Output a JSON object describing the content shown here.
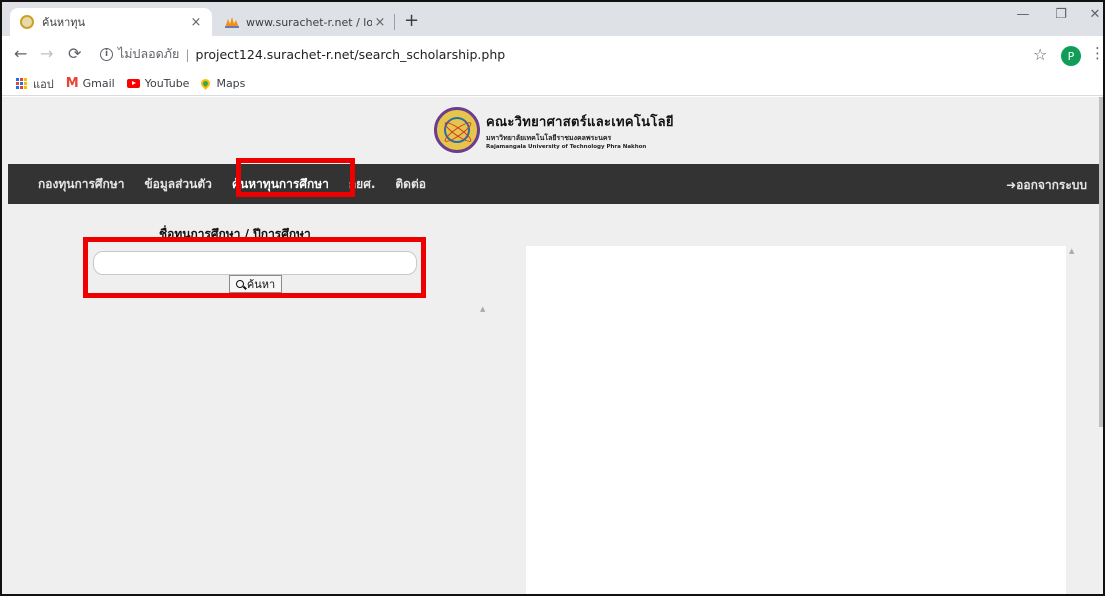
{
  "browser": {
    "tabs": [
      {
        "title": "ค้นหาทุน",
        "active": true
      },
      {
        "title": "www.surachet-r.net / localhost / ",
        "active": false
      }
    ],
    "tab_close": "×",
    "new_tab": "+",
    "window_controls": {
      "minimize": "—",
      "restore": "❐",
      "close": "✕"
    },
    "address": {
      "not_secure": "ไม่ปลอดภัย",
      "url": "project124.surachet-r.net/search_scholarship.php",
      "separator": "|"
    },
    "profile_initial": "P",
    "bookmarks": [
      {
        "label": "แอป",
        "icon": "apps-icon"
      },
      {
        "label": "Gmail",
        "icon": "gmail-icon"
      },
      {
        "label": "YouTube",
        "icon": "youtube-icon"
      },
      {
        "label": "Maps",
        "icon": "maps-icon"
      }
    ]
  },
  "site": {
    "logo": {
      "title": "คณะวิทยาศาสตร์และเทคโนโลยี",
      "subtitle": "มหาวิทยาลัยเทคโนโลยีราชมงคลพระนคร",
      "english": "Rajamangala University of Technology Phra Nakhon"
    },
    "nav": {
      "items": [
        "กองทุนการศึกษา",
        "ข้อมูลส่วนตัว",
        "ค้นหาทุนการศึกษา",
        "กยศ.",
        "ติดต่อ"
      ],
      "active_index": 2,
      "logout": "ออกจากระบบ"
    },
    "search": {
      "label": "ชื่อทุนการศึกษา / ปีการศึกษา",
      "value": "",
      "button": "ค้นหา"
    }
  },
  "colors": {
    "navbar_bg": "#333333",
    "highlight": "#ee0000",
    "page_bg": "#efefef"
  }
}
